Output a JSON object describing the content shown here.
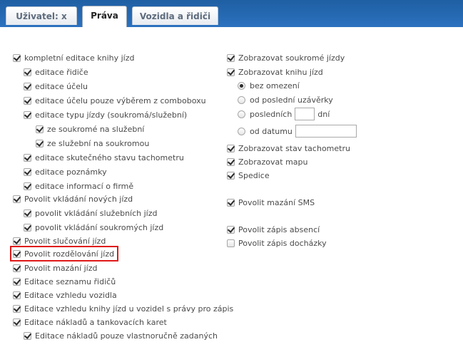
{
  "tabs": {
    "user": "Uživatel: x",
    "rights": "Práva",
    "vehicles": "Vozidla a řidiči"
  },
  "left": [
    {
      "label": "kompletní editace knihy jízd",
      "checked": true,
      "indent": 0
    },
    {
      "label": "editace řidiče",
      "checked": true,
      "indent": 1
    },
    {
      "label": "editace účelu",
      "checked": true,
      "indent": 1
    },
    {
      "label": "editace účelu pouze výběrem z comboboxu",
      "checked": true,
      "indent": 1
    },
    {
      "label": "editace typu jízdy (soukromá/služební)",
      "checked": true,
      "indent": 1
    },
    {
      "label": "ze soukromé na služební",
      "checked": true,
      "indent": 2
    },
    {
      "label": "ze služební na soukromou",
      "checked": true,
      "indent": 2
    },
    {
      "label": "editace skutečného stavu tachometru",
      "checked": true,
      "indent": 1
    },
    {
      "label": "editace poznámky",
      "checked": true,
      "indent": 1
    },
    {
      "label": "editace informací o firmě",
      "checked": true,
      "indent": 1
    },
    {
      "label": "Povolit vkládání nových jízd",
      "checked": true,
      "indent": 0
    },
    {
      "label": "povolit vkládání služebních jízd",
      "checked": true,
      "indent": 1
    },
    {
      "label": "povolit vkládání soukromých jízd",
      "checked": true,
      "indent": 1
    },
    {
      "label": "Povolit slučování jízd",
      "checked": true,
      "indent": 0
    },
    {
      "label": "Povolit rozdělování jízd",
      "checked": true,
      "indent": 0
    },
    {
      "label": "Povolit mazání jízd",
      "checked": true,
      "indent": 0
    },
    {
      "label": "Editace seznamu řidičů",
      "checked": true,
      "indent": 0
    },
    {
      "label": "Editace vzhledu vozidla",
      "checked": true,
      "indent": 0
    },
    {
      "label": "Editace vzhledu knihy jízd u vozidel s právy pro zápis",
      "checked": true,
      "indent": 0
    },
    {
      "label": "Editace nákladů a tankovacích karet",
      "checked": true,
      "indent": 0
    },
    {
      "label": "Editace nákladů pouze vlastnoručně zadaných",
      "checked": true,
      "indent": 1
    }
  ],
  "right": {
    "show_private": "Zobrazovat soukromé jízdy",
    "show_logbook": "Zobrazovat knihu jízd",
    "no_limit": "bez omezení",
    "from_last_close": "od poslední uzávěrky",
    "last": "posledních",
    "days": "dní",
    "from_date": "od datumu",
    "show_odometer": "Zobrazovat stav tachometru",
    "show_map": "Zobrazovat mapu",
    "forwarding": "Spedice",
    "allow_sms_delete": "Povolit mazání SMS",
    "allow_absence": "Povolit zápis absencí",
    "allow_attendance": "Povolit zápis docházky"
  }
}
